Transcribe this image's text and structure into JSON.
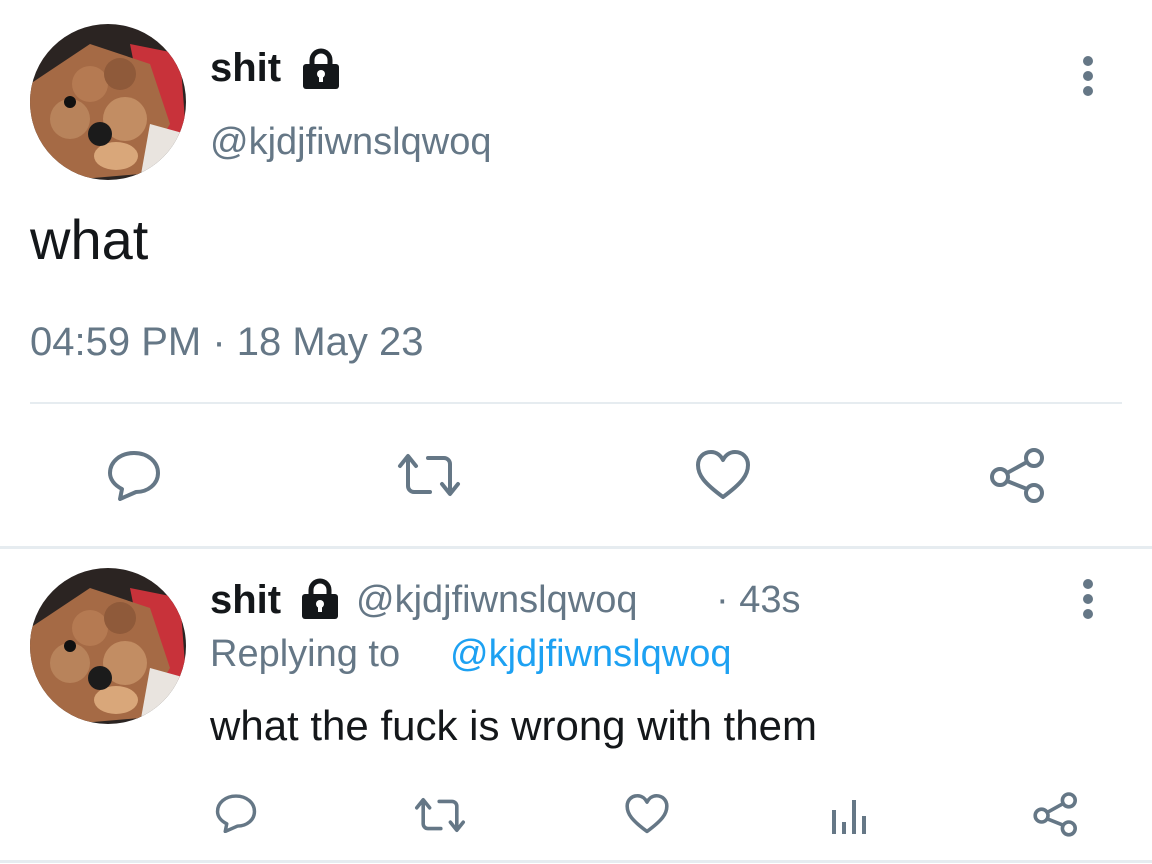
{
  "main_tweet": {
    "display_name": "shit",
    "handle": "@kjdjfiwnslqwoq",
    "text": "what",
    "timestamp": "04:59 PM · 18 May 23",
    "avatar_icon": "dog-avatar",
    "protected_icon": "lock-icon",
    "actions": [
      "reply-icon",
      "retweet-icon",
      "like-icon",
      "share-icon"
    ]
  },
  "reply_tweet": {
    "display_name": "shit",
    "handle": "@kjdjfiwnslqwoq",
    "time_ago": "· 43s",
    "replying_label": "Replying to",
    "replying_handle": "@kjdjfiwnslqwoq",
    "text": "what the fuck is wrong with them",
    "avatar_icon": "dog-avatar",
    "protected_icon": "lock-icon",
    "actions": [
      "reply-icon",
      "retweet-icon",
      "like-icon",
      "analytics-icon",
      "share-icon"
    ]
  },
  "colors": {
    "text": "#14171a",
    "muted": "#657786",
    "link": "#1da1f2",
    "divider": "#e6ecf0"
  }
}
